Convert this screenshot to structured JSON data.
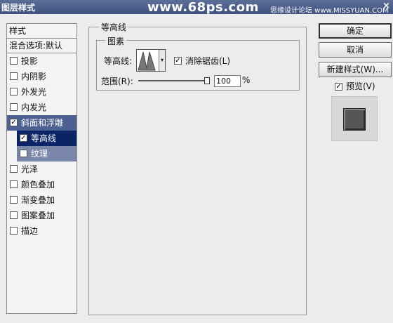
{
  "window": {
    "title": "图层样式",
    "close": "×"
  },
  "watermark": {
    "main": "www.68ps.com",
    "secondary": "思缘设计论坛 www.MISSYUAN.COM"
  },
  "left_panel": {
    "header": "样式",
    "blend_options": "混合选项:默认",
    "items": [
      {
        "label": "投影",
        "checked": false
      },
      {
        "label": "内阴影",
        "checked": false
      },
      {
        "label": "外发光",
        "checked": false
      },
      {
        "label": "内发光",
        "checked": false
      },
      {
        "label": "斜面和浮雕",
        "checked": true
      },
      {
        "label": "等高线",
        "checked": true
      },
      {
        "label": "纹理",
        "checked": false
      },
      {
        "label": "光泽",
        "checked": false
      },
      {
        "label": "颜色叠加",
        "checked": false
      },
      {
        "label": "渐变叠加",
        "checked": false
      },
      {
        "label": "图案叠加",
        "checked": false
      },
      {
        "label": "描边",
        "checked": false
      }
    ]
  },
  "main": {
    "group_title": "等高线",
    "subgroup_title": "图素",
    "contour_label": "等高线:",
    "antialias_label": "消除锯齿(L)",
    "antialias_checked": true,
    "range_label": "范围(R):",
    "range_value": "100",
    "range_unit": "%",
    "range_fraction": 1.0
  },
  "buttons": {
    "ok": "确定",
    "cancel": "取消",
    "new_style": "新建样式(W)...",
    "preview_label": "预览(V)",
    "preview_checked": true
  },
  "colors": {
    "titlebar": "#4a5c8a",
    "selection": "#0a2466"
  }
}
